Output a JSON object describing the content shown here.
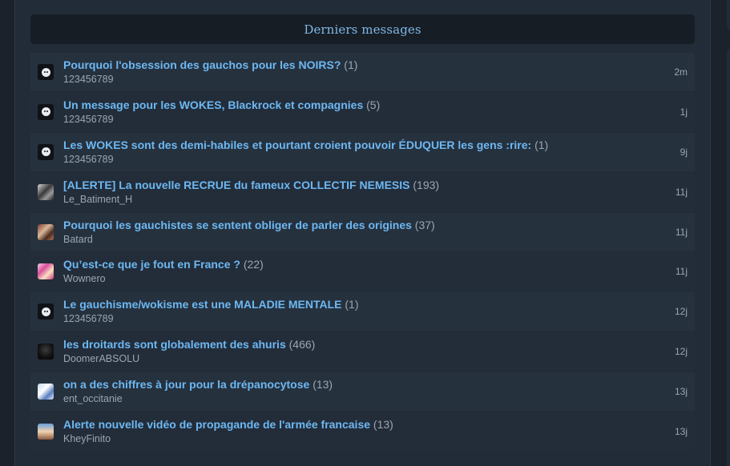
{
  "header": {
    "title": "Derniers messages"
  },
  "messages": [
    {
      "title": "Pourquoi l'obsession des gauchos pour les NOIRS?",
      "count": "(1)",
      "author": "123456789",
      "time": "2m",
      "avatar": "default-avatar-icon"
    },
    {
      "title": "Un message pour les WOKES, Blackrock et compagnies",
      "count": "(5)",
      "author": "123456789",
      "time": "1j",
      "avatar": "default-avatar-icon"
    },
    {
      "title": "Les WOKES sont des demi-habiles et pourtant croient pouvoir ÉDUQUER les gens :rire:",
      "count": "(1)",
      "author": "123456789",
      "time": "9j",
      "avatar": "default-avatar-icon"
    },
    {
      "title": "[ALERTE] La nouvelle RECRUE du fameux COLLECTIF NEMESIS",
      "count": "(193)",
      "author": "Le_Batiment_H",
      "time": "11j",
      "avatar": "user-avatar-icon"
    },
    {
      "title": "Pourquoi les gauchistes se sentent obliger de parler des origines",
      "count": "(37)",
      "author": "Batard",
      "time": "11j",
      "avatar": "user-avatar-icon"
    },
    {
      "title": "Qu’est-ce que je fout en France ?",
      "count": "(22)",
      "author": "Wownero",
      "time": "11j",
      "avatar": "user-avatar-icon"
    },
    {
      "title": "Le gauchisme/wokisme est une MALADIE MENTALE",
      "count": "(1)",
      "author": "123456789",
      "time": "12j",
      "avatar": "default-avatar-icon"
    },
    {
      "title": "les droitards sont globalement des ahuris",
      "count": "(466)",
      "author": "DoomerABSOLU",
      "time": "12j",
      "avatar": "user-avatar-icon"
    },
    {
      "title": "on a des chiffres à jour pour la drépanocytose",
      "count": "(13)",
      "author": "ent_occitanie",
      "time": "13j",
      "avatar": "user-avatar-icon"
    },
    {
      "title": "Alerte nouvelle vidéo de propagande de l'armée francaise",
      "count": "(13)",
      "author": "KheyFinito",
      "time": "13j",
      "avatar": "user-avatar-icon"
    }
  ],
  "colors": {
    "background": "#1b222b",
    "panel": "#222c38",
    "row": "#26313e",
    "header": "#171d24",
    "link": "#6db8f2",
    "muted": "#9aa6b2",
    "header_text": "#7fb8e8"
  }
}
